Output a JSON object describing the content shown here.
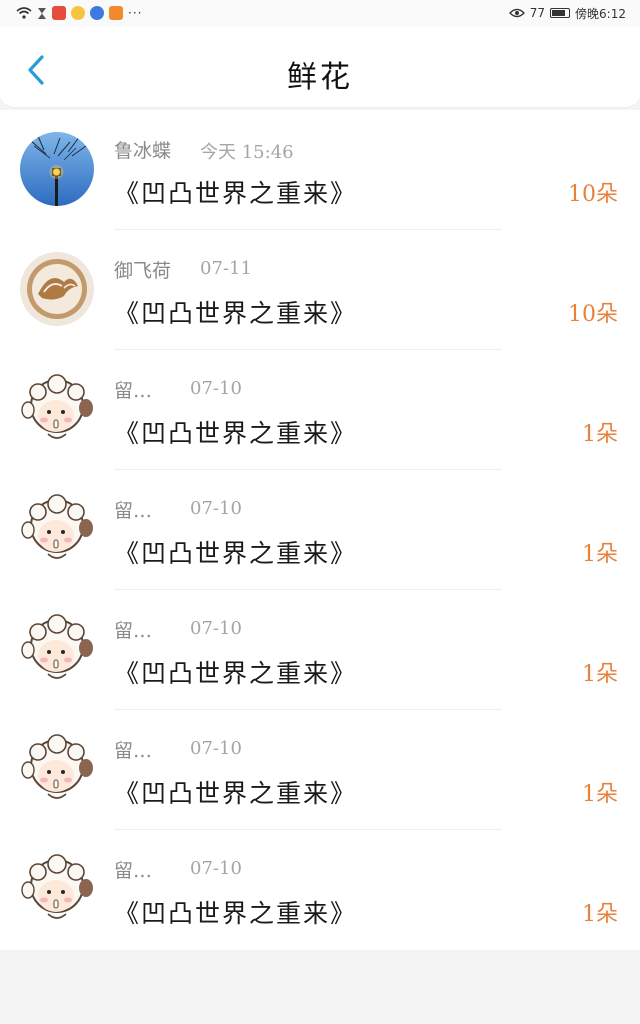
{
  "status_bar": {
    "time": "傍晚6:12",
    "battery": "77",
    "more": "···",
    "icons": [
      "wifi-icon",
      "hourglass-icon",
      "red-app-icon",
      "weibo-icon",
      "music-icon",
      "video-icon"
    ]
  },
  "header": {
    "title": "鲜花",
    "back_icon": "chevron-left-icon"
  },
  "colors": {
    "accent_blue": "#2a9bd6",
    "flower_orange": "#e8813a",
    "name_gray": "#8a8a8a"
  },
  "rows": [
    {
      "name": "鲁冰蝶",
      "date": "今天 15:46",
      "work": "《凹凸世界之重来》",
      "count": "10朵",
      "avatar": "street-lamp-avatar"
    },
    {
      "name": "御飞荷",
      "date": "07-11",
      "work": "《凹凸世界之重来》",
      "count": "10朵",
      "avatar": "latte-art-avatar"
    },
    {
      "name": "留…",
      "date": "07-10",
      "work": "《凹凸世界之重来》",
      "count": "1朵",
      "avatar": "sheep-avatar"
    },
    {
      "name": "留…",
      "date": "07-10",
      "work": "《凹凸世界之重来》",
      "count": "1朵",
      "avatar": "sheep-avatar"
    },
    {
      "name": "留…",
      "date": "07-10",
      "work": "《凹凸世界之重来》",
      "count": "1朵",
      "avatar": "sheep-avatar"
    },
    {
      "name": "留…",
      "date": "07-10",
      "work": "《凹凸世界之重来》",
      "count": "1朵",
      "avatar": "sheep-avatar"
    },
    {
      "name": "留…",
      "date": "07-10",
      "work": "《凹凸世界之重来》",
      "count": "1朵",
      "avatar": "sheep-avatar"
    }
  ]
}
